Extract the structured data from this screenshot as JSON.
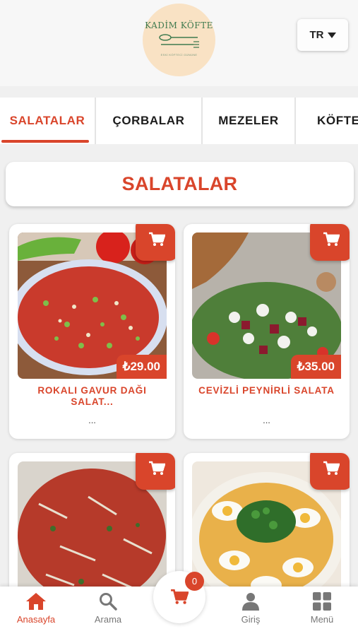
{
  "header": {
    "logo_title": "KADİM KÖFTE",
    "logo_subtitle": "ESKİ KÖFTECİ GÜNÜNE",
    "language": "TR"
  },
  "tabs": [
    {
      "label": "SALATALAR",
      "active": true
    },
    {
      "label": "ÇORBALAR",
      "active": false
    },
    {
      "label": "MEZELER",
      "active": false
    },
    {
      "label": "KÖFTELER",
      "active": false
    }
  ],
  "section_title": "SALATALAR",
  "products": [
    {
      "name": "ROKALI GAVUR DAĞI SALAT...",
      "price": "₺29.00",
      "more": "..."
    },
    {
      "name": "CEVİZLİ PEYNİRLİ SALATA",
      "price": "₺35.00",
      "more": "..."
    },
    {
      "name": "",
      "price": "",
      "more": ""
    },
    {
      "name": "",
      "price": "",
      "more": ""
    }
  ],
  "cart": {
    "count": "0"
  },
  "bottom_nav": [
    {
      "label": "Anasayfa",
      "icon": "home-icon",
      "active": true
    },
    {
      "label": "Arama",
      "icon": "search-icon",
      "active": false
    },
    {
      "label": "Giriş",
      "icon": "user-icon",
      "active": false
    },
    {
      "label": "Menü",
      "icon": "grid-menu-icon",
      "active": false
    }
  ],
  "colors": {
    "accent": "#d9452b",
    "background": "#f0f0f0"
  }
}
